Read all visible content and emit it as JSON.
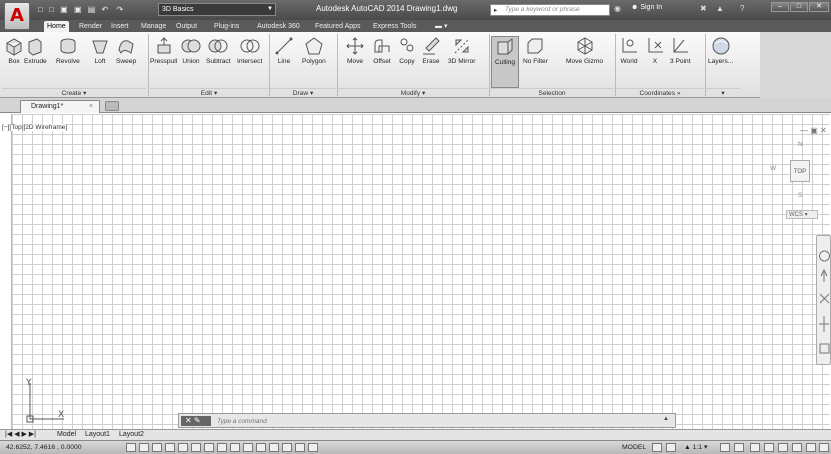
{
  "app": {
    "logo": "A",
    "title": "Autodesk AutoCAD 2014    Drawing1.dwg",
    "workspace": "3D Basics",
    "search_placeholder": "Type a keyword or phrase",
    "signin": "Sign In"
  },
  "tabs": [
    "Home",
    "Render",
    "Insert",
    "Manage",
    "Output",
    "Plug-ins",
    "Autodesk 360",
    "Featured Apps",
    "Express Tools"
  ],
  "ribbon": {
    "create": {
      "title": "Create",
      "items": [
        "Box",
        "Extrude",
        "Revolve",
        "Loft",
        "Sweep"
      ]
    },
    "edit": {
      "title": "Edit",
      "items": [
        "Presspull",
        "Union",
        "Subtract",
        "Intersect"
      ]
    },
    "draw": {
      "title": "Draw",
      "items": [
        "Line",
        "Polygon"
      ]
    },
    "modify": {
      "title": "Modify",
      "items": [
        "Move",
        "Offset",
        "Copy",
        "Erase",
        "3D Mirror"
      ]
    },
    "selection": {
      "title": "Selection",
      "items": [
        "Culling",
        "No Filter",
        "Move Gizmo"
      ]
    },
    "coordinates": {
      "title": "Coordinates",
      "items": [
        "World",
        "X",
        "3 Point"
      ]
    },
    "layers": {
      "items": [
        "Layers..."
      ]
    }
  },
  "document": {
    "tab": "Drawing1*"
  },
  "viewport": {
    "label": "[−][Top][2D Wireframe]",
    "viewcube": {
      "top": "TOP",
      "n": "N",
      "w": "W",
      "s": "S",
      "wcs": "WCS"
    },
    "ucs": {
      "x": "X",
      "y": "Y"
    }
  },
  "command": {
    "placeholder": "Type a command"
  },
  "layouts": [
    "Model",
    "Layout1",
    "Layout2"
  ],
  "status": {
    "coords": "42.6252, 7.4616 , 0.0000",
    "model": "MODEL",
    "scale": "1:1"
  }
}
